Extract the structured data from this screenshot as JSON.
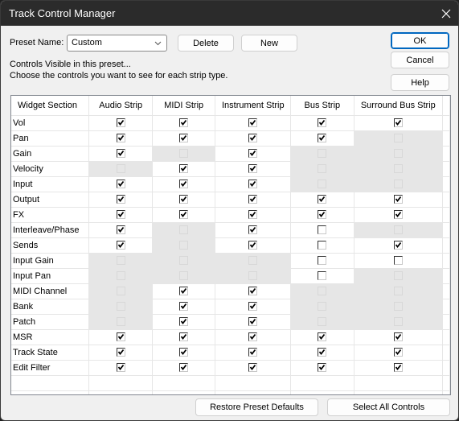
{
  "window": {
    "title": "Track Control Manager",
    "close_icon": "close-icon"
  },
  "preset": {
    "label": "Preset Name:",
    "value": "Custom",
    "delete_label": "Delete",
    "new_label": "New"
  },
  "buttons": {
    "ok": "OK",
    "cancel": "Cancel",
    "help": "Help",
    "restore": "Restore Preset Defaults",
    "select_all": "Select All Controls"
  },
  "info": {
    "line1": "Controls Visible in this preset...",
    "line2": "Choose the controls you want to see for each strip type."
  },
  "grid": {
    "columns": [
      "Widget Section",
      "Audio Strip",
      "MIDI Strip",
      "Instrument Strip",
      "Bus Strip",
      "Surround Bus Strip"
    ],
    "state_legend": {
      "C": "checked",
      "U": "unchecked",
      "D": "disabled"
    },
    "rows": [
      {
        "name": "Vol",
        "states": [
          "C",
          "C",
          "C",
          "C",
          "C"
        ]
      },
      {
        "name": "Pan",
        "states": [
          "C",
          "C",
          "C",
          "C",
          "D"
        ]
      },
      {
        "name": "Gain",
        "states": [
          "C",
          "D",
          "C",
          "D",
          "D"
        ]
      },
      {
        "name": "Velocity",
        "states": [
          "D",
          "C",
          "C",
          "D",
          "D"
        ]
      },
      {
        "name": "Input",
        "states": [
          "C",
          "C",
          "C",
          "D",
          "D"
        ]
      },
      {
        "name": "Output",
        "states": [
          "C",
          "C",
          "C",
          "C",
          "C"
        ]
      },
      {
        "name": "FX",
        "states": [
          "C",
          "C",
          "C",
          "C",
          "C"
        ]
      },
      {
        "name": "Interleave/Phase",
        "states": [
          "C",
          "D",
          "C",
          "U",
          "D"
        ]
      },
      {
        "name": "Sends",
        "states": [
          "C",
          "D",
          "C",
          "U",
          "C"
        ]
      },
      {
        "name": "Input Gain",
        "states": [
          "D",
          "D",
          "D",
          "U",
          "U"
        ]
      },
      {
        "name": "Input Pan",
        "states": [
          "D",
          "D",
          "D",
          "U",
          "D"
        ]
      },
      {
        "name": "MIDI Channel",
        "states": [
          "D",
          "C",
          "C",
          "D",
          "D"
        ]
      },
      {
        "name": "Bank",
        "states": [
          "D",
          "C",
          "C",
          "D",
          "D"
        ]
      },
      {
        "name": "Patch",
        "states": [
          "D",
          "C",
          "C",
          "D",
          "D"
        ]
      },
      {
        "name": "MSR",
        "states": [
          "C",
          "C",
          "C",
          "C",
          "C"
        ]
      },
      {
        "name": "Track State",
        "states": [
          "C",
          "C",
          "C",
          "C",
          "C"
        ]
      },
      {
        "name": "Edit Filter",
        "states": [
          "C",
          "C",
          "C",
          "C",
          "C"
        ]
      }
    ]
  },
  "colors": {
    "titlebar": "#2b2b2b",
    "dialog_bg": "#f0f0f0",
    "disabled_cell": "#e6e6e6",
    "default_button_border": "#0067c0"
  }
}
